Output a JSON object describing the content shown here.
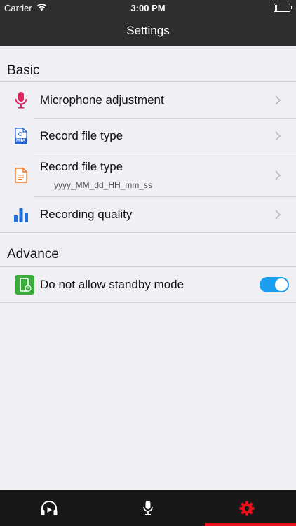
{
  "status_bar": {
    "carrier": "Carrier",
    "time": "3:00 PM",
    "battery_level": 0.15
  },
  "nav": {
    "title": "Settings"
  },
  "basic": {
    "header": "Basic",
    "items": [
      {
        "label": "Microphone adjustment",
        "icon": "microphone-icon"
      },
      {
        "label": "Record file type",
        "icon": "m4a-file-icon",
        "badge": "M4A"
      },
      {
        "label": "Record file type",
        "sublabel": "yyyy_MM_dd_HH_mm_ss",
        "icon": "document-icon"
      },
      {
        "label": "Recording quality",
        "icon": "bar-chart-icon"
      }
    ]
  },
  "advance": {
    "header": "Advance",
    "items": [
      {
        "label": "Do not allow standby mode",
        "icon": "phone-standby-icon",
        "toggle_on": true
      }
    ]
  },
  "tabs": [
    {
      "name": "player",
      "icon": "headphones-play-icon",
      "active": false
    },
    {
      "name": "record",
      "icon": "microphone-tab-icon",
      "active": false
    },
    {
      "name": "settings",
      "icon": "gear-icon",
      "active": true
    }
  ],
  "colors": {
    "bar_bg": "#2e2e2e",
    "tab_bg": "#181818",
    "accent_red": "#e8101a",
    "toggle_blue": "#1a9ef0",
    "mic_pink": "#e0245e",
    "doc_orange": "#f07a2a",
    "chart_blue": "#1e6fd9",
    "standby_green": "#3aab3a"
  }
}
